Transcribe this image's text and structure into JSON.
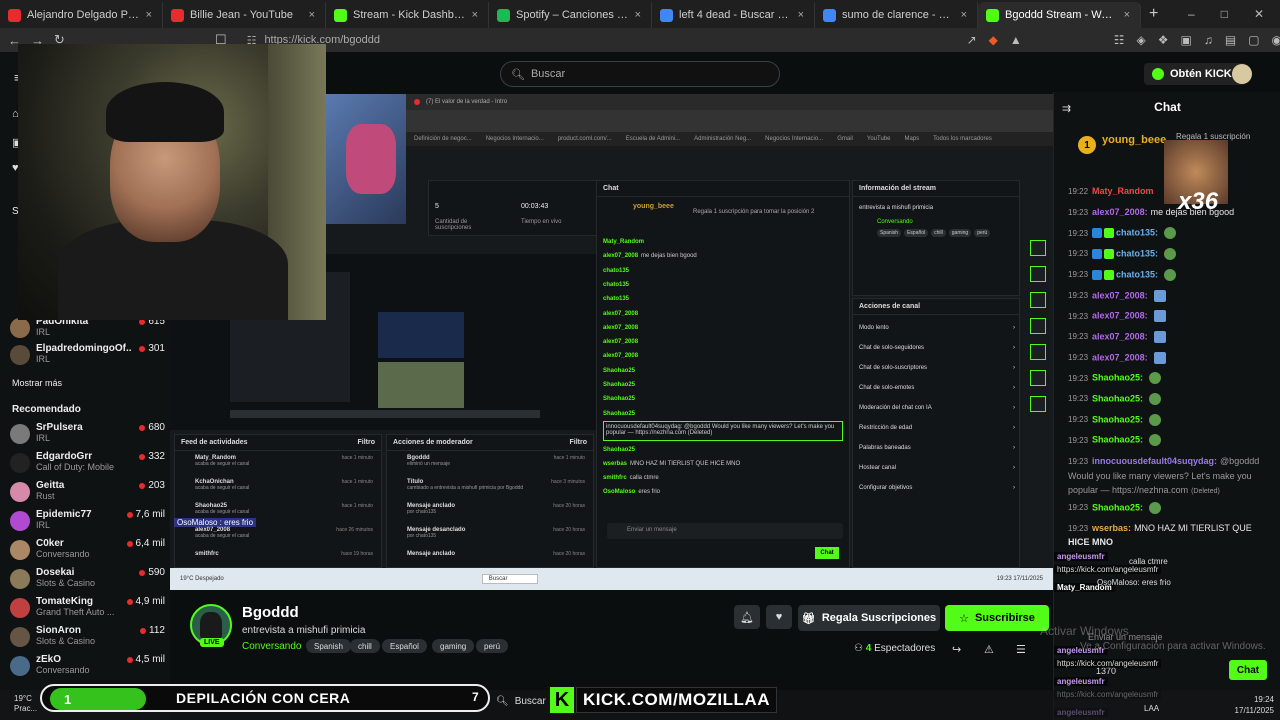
{
  "browser": {
    "tabs": [
      {
        "title": "Alejandro Delgado Pérez - YouTube",
        "icon": "youtube-icon",
        "color": "#e62c2c"
      },
      {
        "title": "Billie Jean - YouTube",
        "icon": "youtube-icon",
        "color": "#e62c2c"
      },
      {
        "title": "Stream - Kick Dashboard",
        "icon": "kick-icon",
        "color": "#53fc18"
      },
      {
        "title": "Spotify – Canciones que te gustan",
        "icon": "spotify-icon",
        "color": "#1db954"
      },
      {
        "title": "left 4 dead - Buscar con Google",
        "icon": "google-icon",
        "color": "#4285f4"
      },
      {
        "title": "sumo de clarence - Buscar con Goog",
        "icon": "google-icon",
        "color": "#4285f4"
      },
      {
        "title": "Bgoddd Stream - Watch Live",
        "icon": "kick-icon",
        "color": "#53fc18"
      }
    ],
    "url": "https://kick.com/bgoddd"
  },
  "header": {
    "search_placeholder": "Buscar",
    "get_kicks": "Obtén KICKs"
  },
  "sidebar": {
    "following_heading": "Si",
    "following": [
      {
        "name": "PadOnikita",
        "category": "IRL",
        "viewers": "615",
        "color": "#8a6a4a"
      },
      {
        "name": "ElpadredomingoOf...",
        "category": "IRL",
        "viewers": "301",
        "color": "#5a4a3a"
      }
    ],
    "show_more": "Mostrar más",
    "recommended_heading": "Recomendado",
    "recommended": [
      {
        "name": "SrPulsera",
        "category": "IRL",
        "viewers": "680",
        "color": "#7a7a7a"
      },
      {
        "name": "EdgardoGrr",
        "category": "Call of Duty: Mobile",
        "viewers": "332",
        "color": "#222"
      },
      {
        "name": "Geitta",
        "category": "Rust",
        "viewers": "203",
        "color": "#d48aa8"
      },
      {
        "name": "Epidemic77",
        "category": "IRL",
        "viewers": "7,6 mil",
        "color": "#b04ad0"
      },
      {
        "name": "C0ker",
        "category": "Conversando",
        "viewers": "6,4 mil",
        "color": "#aa8866"
      },
      {
        "name": "Dosekai",
        "category": "Slots & Casino",
        "viewers": "590",
        "color": "#8a7a5a"
      },
      {
        "name": "TomateKing",
        "category": "Grand Theft Auto ...",
        "viewers": "4,9 mil",
        "color": "#c04040"
      },
      {
        "name": "SionAron",
        "category": "Slots & Casino",
        "viewers": "112",
        "color": "#665544"
      },
      {
        "name": "zEkO",
        "category": "Conversando",
        "viewers": "4,5 mil",
        "color": "#4a6a8a"
      }
    ]
  },
  "stream_capture": {
    "inner_tab": "(7) El valor de la verdad - Intro",
    "bookmarks": [
      "Definición de negoc...",
      "Negocios Internacio...",
      "product.coml.com/...",
      "Escuela de Admini...",
      "Administración Neg...",
      "Negocios Internacio...",
      "Gmail",
      "YouTube",
      "Maps",
      "Todos los marcadores"
    ],
    "stats": [
      {
        "value": "5",
        "label": "Cantidad de suscripciones"
      },
      {
        "value": "00:03:43",
        "label": "Tiempo en vivo"
      }
    ],
    "chat_header": "Chat",
    "top_gift_user": "young_beee",
    "top_gift_text": "Regala 1 suscripción para tomar la posición 2",
    "mini_chat": [
      {
        "user": "Maty_Random",
        "msg": ""
      },
      {
        "user": "alex07_2008",
        "msg": "me dejas bien bgood"
      },
      {
        "user": "chato135",
        "msg": ""
      },
      {
        "user": "chato135",
        "msg": ""
      },
      {
        "user": "chato135",
        "msg": ""
      },
      {
        "user": "alex07_2008",
        "msg": ""
      },
      {
        "user": "alex07_2008",
        "msg": ""
      },
      {
        "user": "alex07_2008",
        "msg": ""
      },
      {
        "user": "alex07_2008",
        "msg": ""
      },
      {
        "user": "Shaohao25",
        "msg": ""
      },
      {
        "user": "Shaohao25",
        "msg": ""
      },
      {
        "user": "Shaohao25",
        "msg": ""
      },
      {
        "user": "Shaohao25",
        "msg": ""
      }
    ],
    "spam_line": "innocuousdefault04suqydag: @bgoddd Would you like many viewers? Let's make you popular — https://nezhna.com (Deleted)",
    "mini_chat2": [
      {
        "user": "Shaohao25",
        "msg": ""
      },
      {
        "user": "wserbas",
        "msg": "MNO HAZ MI TIERLIST QUE HICE MNO"
      },
      {
        "user": "smithfrc",
        "msg": "calla ctmre"
      },
      {
        "user": "OsoMaloso",
        "msg": "eres frio"
      }
    ],
    "send_placeholder": "Enviar un mensaje",
    "chat_button": "Chat",
    "info_header": "Información del stream",
    "info_title": "entrevista a mishufi primicia",
    "info_cat": "Conversando",
    "info_tags": [
      "Spanish",
      "Español",
      "chill",
      "gaming",
      "perú"
    ],
    "mod_actions_header": "Acciones de canal",
    "mod_actions": [
      "Modo lento",
      "Chat de solo-seguidores",
      "Chat de solo-suscriptores",
      "Chat de solo-emotes",
      "Moderación del chat con IA",
      "Restricción de edad",
      "Palabras baneadas",
      "Hostear canal",
      "Configurar objetivos"
    ],
    "activity_header": "Feed de actividades",
    "activity_filter": "Filtro",
    "activity": [
      {
        "user": "Maty_Random",
        "text": "acaba de seguir el canal",
        "time": "hace 1 minuto"
      },
      {
        "user": "KchaOnichan",
        "text": "acaba de seguir el canal",
        "time": "hace 1 minuto"
      },
      {
        "user": "Shaohao25",
        "text": "acaba de seguir el canal",
        "time": "hace 1 minuto"
      },
      {
        "user": "alex07_2008",
        "text": "acaba de seguir el canal",
        "time": "hace 26 minutos"
      },
      {
        "user": "smithfrc",
        "text": "",
        "time": "hace 19 horas"
      }
    ],
    "moderator_header": "Acciones de moderador",
    "moderator_filter": "Filtro",
    "moderator": [
      {
        "title": "Bgoddd",
        "text": "eliminó un mensaje",
        "time": "hace 1 minuto"
      },
      {
        "title": "Título",
        "text": "cambiado a entrevista a mishufi primicia por Bgoddd",
        "time": "hace 3 minutos"
      },
      {
        "title": "Mensaje anclado",
        "text": "por chato135",
        "time": "hace 20 horas"
      },
      {
        "title": "Mensaje desanclado",
        "text": "por chato135",
        "time": "hace 20 horas"
      },
      {
        "title": "Mensaje anclado",
        "text": "",
        "time": "hace 20 horas"
      }
    ],
    "overlay_msg": "OsoMaloso : eres frio",
    "taskbar_search": "Buscar",
    "weather": "19°C Despejado",
    "clock": "19:23 17/11/2025"
  },
  "channel": {
    "name": "Bgoddd",
    "title": "entrevista a mishufi primicia",
    "category": "Conversando",
    "tags": [
      "Spanish",
      "chill",
      "Español",
      "gaming",
      "perú"
    ],
    "live": "LIVE",
    "gift_label": "Regala Suscripciones",
    "subscribe_label": "Suscribirse",
    "viewers": "4",
    "viewers_label": "Espectadores"
  },
  "chat": {
    "title": "Chat",
    "pinned_user": "young_beee",
    "pinned_text": "Regala 1 suscripción",
    "combo": "x36",
    "messages": [
      {
        "time": "19:22",
        "user": "Maty_Random",
        "color": "#e84a4a",
        "msg": "",
        "emote": ""
      },
      {
        "time": "19:23",
        "user": "alex07_2008:",
        "color": "#b06ae8",
        "msg": "me dejas bien bgood",
        "emote": ""
      },
      {
        "time": "19:23",
        "user": "chato135:",
        "color": "#6ab0f0",
        "msg": "",
        "emote": "pepe"
      },
      {
        "time": "19:23",
        "user": "chato135:",
        "color": "#6ab0f0",
        "msg": "",
        "emote": "pepe"
      },
      {
        "time": "19:23",
        "user": "chato135:",
        "color": "#6ab0f0",
        "msg": "",
        "emote": "pepe"
      },
      {
        "time": "19:23",
        "user": "alex07_2008:",
        "color": "#b06ae8",
        "msg": "",
        "emote": "blue"
      },
      {
        "time": "19:23",
        "user": "alex07_2008:",
        "color": "#b06ae8",
        "msg": "",
        "emote": "blue"
      },
      {
        "time": "19:23",
        "user": "alex07_2008:",
        "color": "#b06ae8",
        "msg": "",
        "emote": "blue"
      },
      {
        "time": "19:23",
        "user": "alex07_2008:",
        "color": "#b06ae8",
        "msg": "",
        "emote": "blue"
      },
      {
        "time": "19:23",
        "user": "Shaohao25:",
        "color": "#53fc18",
        "msg": "",
        "emote": "pepe"
      },
      {
        "time": "19:23",
        "user": "Shaohao25:",
        "color": "#53fc18",
        "msg": "",
        "emote": "pepe"
      },
      {
        "time": "19:23",
        "user": "Shaohao25:",
        "color": "#53fc18",
        "msg": "",
        "emote": "pepe"
      },
      {
        "time": "19:23",
        "user": "Shaohao25:",
        "color": "#53fc18",
        "msg": "",
        "emote": "pepe"
      }
    ],
    "spam_user": "innocuousdefault04suqydag:",
    "spam_line1": "@bgoddd",
    "spam_line2": "Would you like many viewers? Let's make you",
    "spam_line3": "popular — https://nezhna.com",
    "spam_deleted": "(Deleted)",
    "after": [
      {
        "time": "19:23",
        "user": "Shaohao25:",
        "color": "#53fc18",
        "msg": "",
        "emote": "pepe"
      },
      {
        "time": "19:23",
        "user": "wserbas:",
        "color": "#e8a84a",
        "msg": "MNO HAZ MI TIERLIST QUE",
        "emote": ""
      }
    ],
    "wrap_text": "HICE MNO",
    "send_placeholder": "Enviar un mensaje",
    "chat_button": "Chat",
    "points": "1370"
  },
  "obs_overlay": {
    "lines": [
      {
        "user": "angeleusmfr",
        "text": ""
      },
      {
        "user": "",
        "text": "https://kick.com/angeleusmfr"
      },
      {
        "user": "Maty_Random",
        "text": ""
      },
      {
        "user": "angeleusmfr",
        "text": ""
      },
      {
        "user": "",
        "text": "https://kick.com/angeleusmfr"
      },
      {
        "user": "angeleusmfr",
        "text": ""
      },
      {
        "user": "",
        "text": "https://kick.com/angeleusmfr"
      },
      {
        "user": "angeleusmfr",
        "text": ""
      }
    ],
    "under1": "calla ctmre",
    "under2": "OsoMaloso: eres frio",
    "activate_windows": "Activar Windows",
    "activate_windows2": "Ve a Configuración para activar Windows.",
    "depilation_number": "1",
    "depilation_text": "DEPILACIÓN CON CERA",
    "depilation_right": "7",
    "kick_url": "KICK.COM/MOZILLAA",
    "kick_letter": "K"
  },
  "windows": {
    "search": "Buscar",
    "weather_temp": "19°C",
    "weather_text": "Prac...",
    "lang": "LAA",
    "time": "19:24",
    "date": "17/11/2025"
  }
}
